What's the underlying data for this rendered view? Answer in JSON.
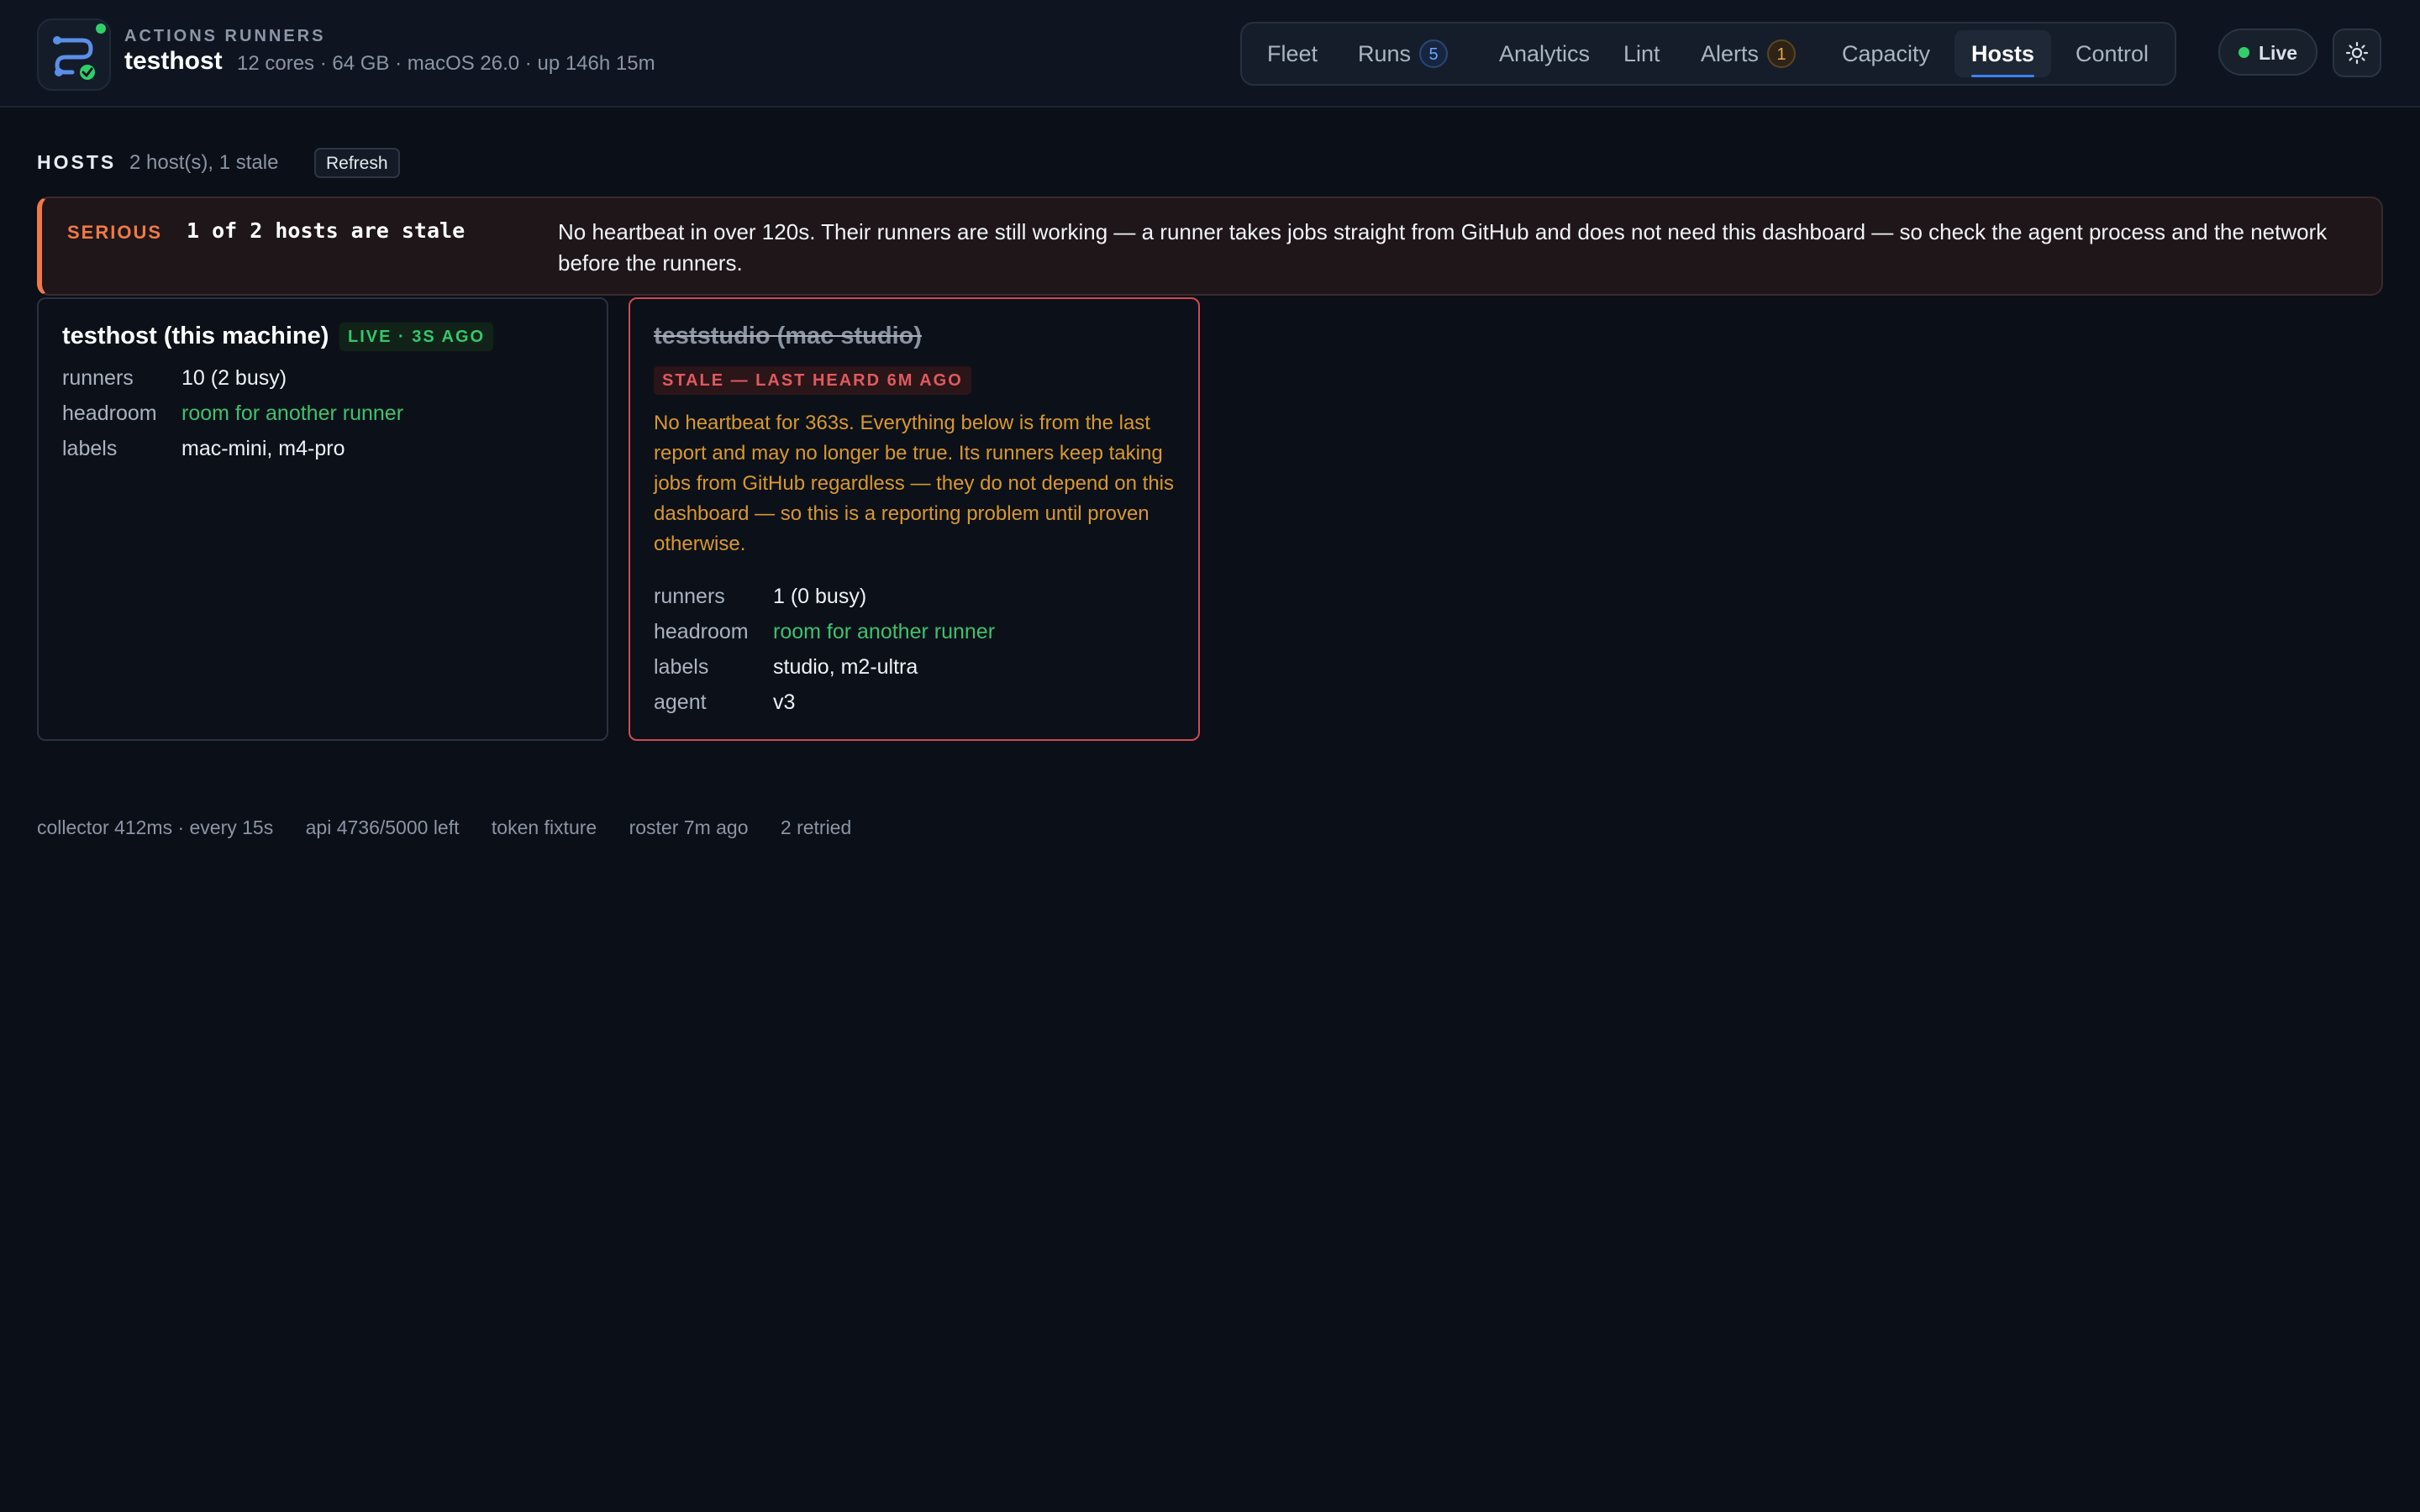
{
  "header": {
    "kicker": "ACTIONS RUNNERS",
    "host": "testhost",
    "meta": "12 cores · 64 GB · macOS 26.0 · up 146h 15m",
    "tabs": [
      {
        "label": "Fleet"
      },
      {
        "label": "Runs",
        "badge": "5"
      },
      {
        "label": "Analytics"
      },
      {
        "label": "Lint"
      },
      {
        "label": "Alerts",
        "badge": "1"
      },
      {
        "label": "Capacity"
      },
      {
        "label": "Hosts",
        "active": true
      },
      {
        "label": "Control"
      }
    ],
    "live_label": "Live",
    "theme_icon": "sun-icon",
    "colors": {
      "accent": "#3b82f6",
      "live": "#2fd06a",
      "alert_badge": "#e9a948"
    }
  },
  "section": {
    "title": "HOSTS",
    "summary": "2 host(s), 1 stale",
    "refresh_label": "Refresh"
  },
  "alert": {
    "severity": "SERIOUS",
    "headline": "1 of 2 hosts are stale",
    "message": "No heartbeat in over 120s. Their runners are still working — a runner takes jobs straight from GitHub and does not need this dashboard — so check the agent process and the network before the runners.",
    "color": "#f07a45"
  },
  "hosts": [
    {
      "name": "testhost (this machine)",
      "status": "LIVE · 3S AGO",
      "rows": [
        {
          "key": "runners",
          "value": "10 (2 busy)"
        },
        {
          "key": "headroom",
          "value": "room for another runner"
        },
        {
          "key": "labels",
          "value": "mac-mini, m4-pro"
        }
      ]
    },
    {
      "name": "teststudio (mac studio)",
      "status": "STALE — LAST HEARD 6M AGO",
      "note": "No heartbeat for 363s. Everything below is from the last report and may no longer be true. Its runners keep taking jobs from GitHub regardless — they do not depend on this dashboard — so this is a reporting problem until proven otherwise.",
      "rows": [
        {
          "key": "runners",
          "value": "1 (0 busy)"
        },
        {
          "key": "headroom",
          "value": "room for another runner"
        },
        {
          "key": "labels",
          "value": "studio, m2-ultra"
        },
        {
          "key": "agent",
          "value": "v3"
        }
      ]
    }
  ],
  "footer": [
    "collector 412ms · every 15s",
    "api 4736/5000 left",
    "token fixture",
    "roster 7m ago",
    "2 retried"
  ]
}
